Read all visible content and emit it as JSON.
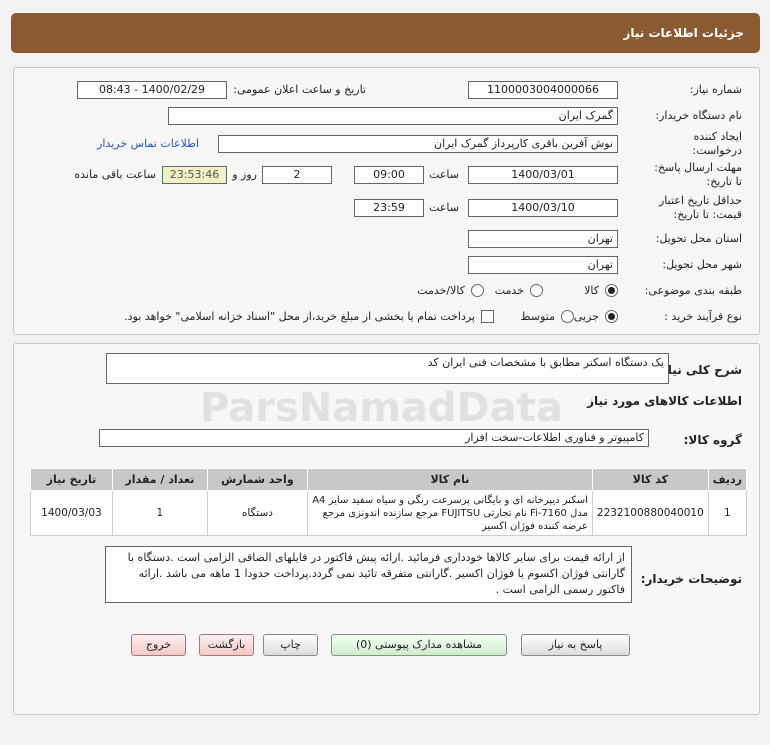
{
  "header": {
    "title": "جزئیات اطلاعات نیاز"
  },
  "form": {
    "need_number_label": "شماره نیاز:",
    "need_number": "1100003004000066",
    "announce_label": "تاریخ و ساعت اعلان عمومی:",
    "announce_value": "1400/02/29 - 08:43",
    "buyer_org_label": "نام دستگاه خریدار:",
    "buyer_org": "گمرک ایران",
    "creator_label": "ایجاد کننده درخواست:",
    "creator": "نوش آفرین باقری کارپرداز گمرک ایران",
    "contact_link": "اطلاعات تماس خریدار",
    "deadline_label": "مهلت ارسال پاسخ: تا تاریخ:",
    "deadline_date": "1400/03/01",
    "time_label": "ساعت",
    "deadline_time": "09:00",
    "days_value": "2",
    "days_label": "روز و",
    "remaining_value": "23:53:46",
    "remaining_label": "ساعت باقی مانده",
    "validity_label": "حداقل تاریخ اعتبار قیمت: تا تاریخ:",
    "validity_date": "1400/03/10",
    "validity_time": "23:59",
    "province_label": "استان محل تحویل:",
    "province": "تهران",
    "city_label": "شهر محل تحویل:",
    "city": "تهران",
    "category_label": "طبقه بندی موضوعی:",
    "category_options": [
      "کالا",
      "خدمت",
      "کالا/خدمت"
    ],
    "process_label": "نوع فرآیند خرید :",
    "process_options": [
      "جزیی",
      "متوسط"
    ],
    "payment_note": "پرداخت تمام یا بخشی از مبلغ خرید،از محل \"اسناد خزانه اسلامی\" خواهد بود."
  },
  "details": {
    "desc_label": "شرح کلی نیاز:",
    "desc": "یک دستگاه اسکنر مطابق با مشخصات فنی ایران کد",
    "goods_info_title": "اطلاعات کالاهای مورد نیاز",
    "group_label": "گروه کالا:",
    "group": "کامپیوتر و فناوری اطلاعات-سخت افزار",
    "table_headers": [
      "ردیف",
      "کد کالا",
      "نام کالا",
      "واحد شمارش",
      "تعداد / مقدار",
      "تاریخ نیاز"
    ],
    "rows": [
      {
        "row": "1",
        "code": "2232100880040010",
        "name": "اسکنر دیپرخانه ای و بایگانی پرسرعت رنگی و سیاه سفید سایز A4 مدل Fi-7160 نام تجارتی FUJITSU مرجع سازنده اندونزی مرجع عرضه کننده فوژان اکسیر",
        "unit": "دستگاه",
        "qty": "1",
        "date": "1400/03/03"
      }
    ],
    "notes_label": "توضیحات خریدار:",
    "notes": "از ارائه قیمت برای سایر کالاها خودداری فرمائید .ارائه پیش فاکتور در فایلهای الصاقی الزامی است .دستگاه با گارانتی فوژان اکسوم یا فوژان اکسیر .گارانتی متفرقه تائید نمی گردد.پرداخت حدودا 1 ماهه می باشد .ارائه فاکتور رسمی الزامی است ."
  },
  "buttons": {
    "reply": "پاسخ به نیاز",
    "attachments": "مشاهده مدارک پیوستی (0)",
    "print": "چاپ",
    "back": "بازگشت",
    "exit": "خروج"
  },
  "watermark": {
    "text": "ParsNamadData"
  }
}
